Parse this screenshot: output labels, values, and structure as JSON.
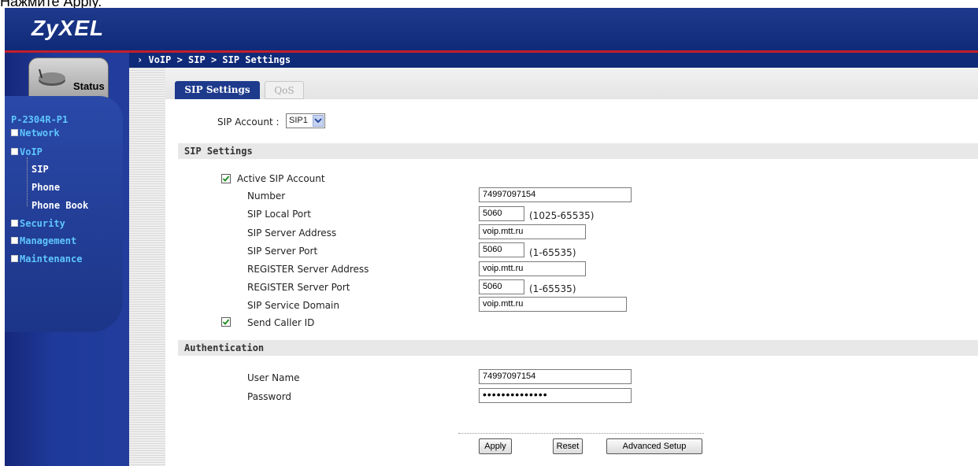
{
  "caption": "Нажмите Apply.",
  "header": {
    "logo": "ZyXEL"
  },
  "sidebar": {
    "status_label": "Status",
    "model": "P-2304R-P1",
    "nav": [
      {
        "label": "Network"
      },
      {
        "label": "VoIP"
      },
      {
        "label": "Security"
      },
      {
        "label": "Management"
      },
      {
        "label": "Maintenance"
      }
    ],
    "voip_children": [
      {
        "label": "SIP"
      },
      {
        "label": "Phone"
      },
      {
        "label": "Phone Book"
      }
    ]
  },
  "breadcrumb": "VoIP > SIP > SIP Settings",
  "tabs": {
    "active": "SIP Settings",
    "inactive": "QoS"
  },
  "sip_account": {
    "label": "SIP Account :",
    "selected": "SIP1"
  },
  "sip_settings": {
    "section_title": "SIP Settings",
    "active_label": "Active SIP Account",
    "active_checked": true,
    "number_label": "Number",
    "number_value": "74997097154",
    "local_port_label": "SIP Local Port",
    "local_port_value": "5060",
    "local_port_range": "(1025-65535)",
    "server_address_label": "SIP Server Address",
    "server_address_value": "voip.mtt.ru",
    "server_port_label": "SIP Server Port",
    "server_port_value": "5060",
    "server_port_range": "(1-65535)",
    "register_address_label": "REGISTER Server Address",
    "register_address_value": "voip.mtt.ru",
    "register_port_label": "REGISTER Server Port",
    "register_port_value": "5060",
    "register_port_range": "(1-65535)",
    "service_domain_label": "SIP Service Domain",
    "service_domain_value": "voip.mtt.ru",
    "send_caller_label": "Send Caller ID",
    "send_caller_checked": true
  },
  "authentication": {
    "section_title": "Authentication",
    "username_label": "User Name",
    "username_value": "74997097154",
    "password_label": "Password",
    "password_value": "••••••••••••••"
  },
  "buttons": {
    "apply": "Apply",
    "reset": "Reset",
    "advanced": "Advanced Setup"
  }
}
